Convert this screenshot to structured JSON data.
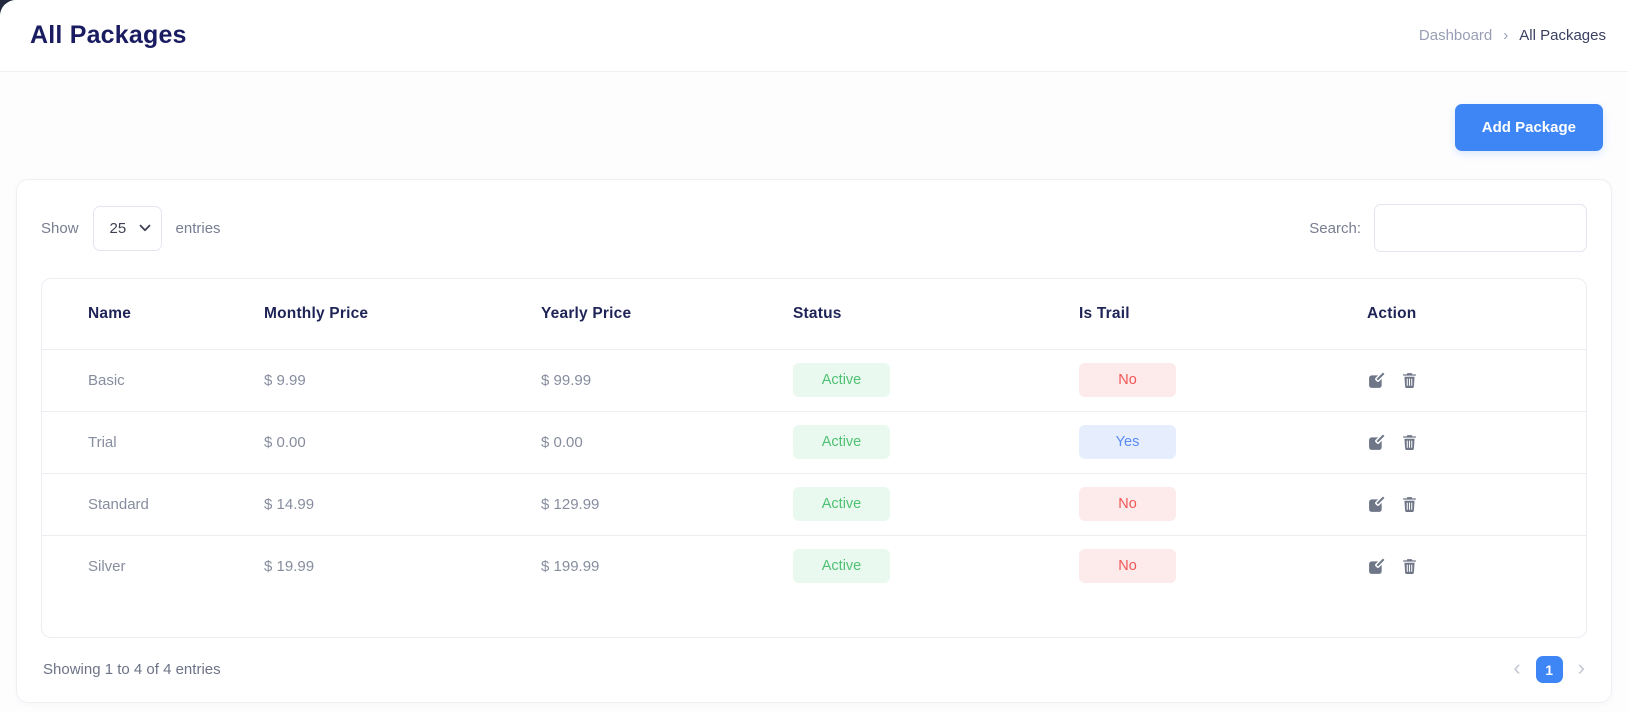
{
  "header": {
    "title": "All Packages",
    "breadcrumb": {
      "items": [
        "Dashboard",
        "All Packages"
      ],
      "separator": "›"
    }
  },
  "toolbar": {
    "add_package_label": "Add Package"
  },
  "panel": {
    "length_menu": {
      "prefix": "Show",
      "selected": "25",
      "suffix": "entries"
    },
    "search": {
      "label": "Search:",
      "value": "",
      "placeholder": ""
    },
    "table": {
      "columns": [
        "Name",
        "Monthly Price",
        "Yearly Price",
        "Status",
        "Is Trail",
        "Action"
      ],
      "rows": [
        {
          "name": "Basic",
          "monthly_price": "$ 9.99",
          "yearly_price": "$ 99.99",
          "status": "Active",
          "status_variant": "green",
          "is_trail": "No",
          "trail_variant": "red"
        },
        {
          "name": "Trial",
          "monthly_price": "$ 0.00",
          "yearly_price": "$ 0.00",
          "status": "Active",
          "status_variant": "green",
          "is_trail": "Yes",
          "trail_variant": "blue"
        },
        {
          "name": "Standard",
          "monthly_price": "$ 14.99",
          "yearly_price": "$ 129.99",
          "status": "Active",
          "status_variant": "green",
          "is_trail": "No",
          "trail_variant": "red"
        },
        {
          "name": "Silver",
          "monthly_price": "$ 19.99",
          "yearly_price": "$ 199.99",
          "status": "Active",
          "status_variant": "green",
          "is_trail": "No",
          "trail_variant": "red"
        }
      ]
    },
    "footer": {
      "info": "Showing 1 to 4 of 4 entries",
      "pagination": {
        "prev": "‹",
        "current": "1",
        "next": "›"
      }
    }
  },
  "icons": {
    "edit": "pencil-square-icon",
    "delete": "trash-icon",
    "select_chevron": "chevron-down-icon",
    "breadcrumb_separator": "chevron-right-icon"
  },
  "colors": {
    "accent_blue": "#3e86f5",
    "title_navy": "#1a1c62",
    "status_active_bg": "#e9f9ef",
    "status_active_text": "#50c174",
    "trail_no_bg": "#fdeaea",
    "trail_no_text": "#ef5757",
    "trail_yes_bg": "#e6eefe",
    "trail_yes_text": "#5a8af2"
  }
}
